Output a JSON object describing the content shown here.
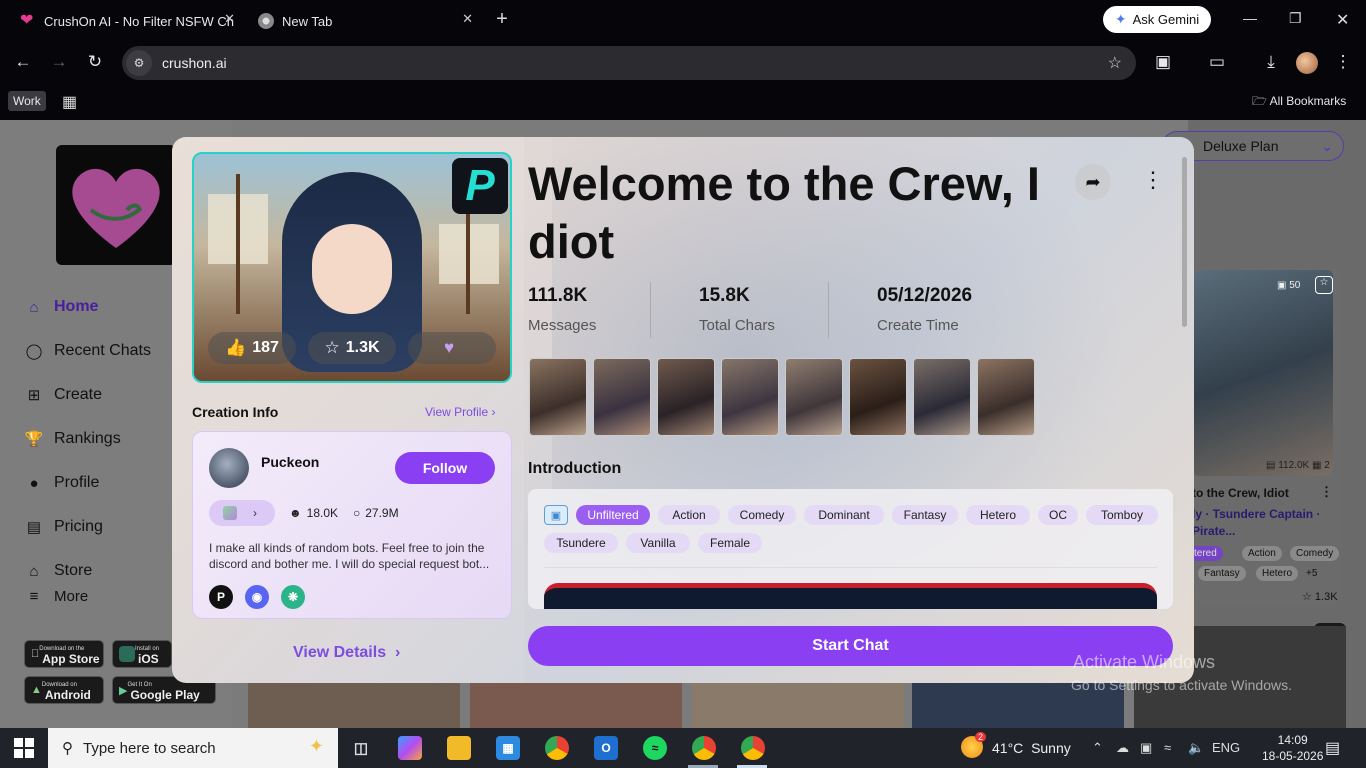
{
  "browser": {
    "tabs": [
      {
        "title": "CrushOn AI - No Filter NSFW Ch",
        "icon": "heart-icon"
      },
      {
        "title": "New Tab",
        "icon": "chrome-icon"
      }
    ],
    "gemini_label": "Ask Gemini",
    "url": "crushon.ai",
    "bookmarks": {
      "workspace": "Work",
      "all": "All Bookmarks"
    }
  },
  "sidebar": {
    "nav": [
      {
        "label": "Home",
        "icon": "home-icon"
      },
      {
        "label": "Recent Chats",
        "icon": "chat-bubble-icon"
      },
      {
        "label": "Create",
        "icon": "plus-square-icon"
      },
      {
        "label": "Rankings",
        "icon": "trophy-icon"
      },
      {
        "label": "Profile",
        "icon": "person-icon"
      },
      {
        "label": "Pricing",
        "icon": "card-icon"
      },
      {
        "label": "Store",
        "icon": "store-icon"
      },
      {
        "label": "More",
        "icon": "menu-icon"
      }
    ],
    "badges": {
      "appstore_small": "Download on the",
      "appstore": "App Store",
      "ios_small": "Install on",
      "ios": "iOS",
      "android_small": "Download on",
      "android": "Android",
      "gplay_small": "Get It On",
      "gplay": "Google Play"
    }
  },
  "header": {
    "plan": "Deluxe Plan"
  },
  "right_card": {
    "img_count": "50",
    "messages": "112.0K",
    "pics": "2",
    "title": "to the Crew, Idiot",
    "subtitle_1": "ly · Tsundere Captain ·",
    "subtitle_2": "Pirate...",
    "tags": [
      "tered",
      "Action",
      "Comedy",
      "Fantasy",
      "Hetero",
      "+5"
    ],
    "likes": "1.3K"
  },
  "modal": {
    "title": "Welcome to the Crew, Idiot",
    "likes": "187",
    "favorites": "1.3K",
    "stats": [
      {
        "value": "111.8K",
        "label": "Messages"
      },
      {
        "value": "15.8K",
        "label": "Total Chars"
      },
      {
        "value": "05/12/2026",
        "label": "Create Time"
      }
    ],
    "creation_label": "Creation Info",
    "view_profile": "View Profile",
    "creator": {
      "name": "Puckeon",
      "follow": "Follow",
      "followers": "18.0K",
      "messages": "27.9M",
      "bio": "I make all kinds of random bots. Feel free to join the discord and bother me. I will do special request bot..."
    },
    "view_details": "View Details",
    "intro_label": "Introduction",
    "tags": [
      "Unfiltered",
      "Action",
      "Comedy",
      "Dominant",
      "Fantasy",
      "Hetero",
      "OC",
      "Tomboy",
      "Tsundere",
      "Vanilla",
      "Female"
    ],
    "start_chat": "Start Chat"
  },
  "watermark": {
    "line1": "Activate Windows",
    "line2": "Go to Settings to activate Windows."
  },
  "taskbar": {
    "search_placeholder": "Type here to search",
    "weather_temp": "41°C",
    "weather_cond": "Sunny",
    "lang": "ENG",
    "time": "14:09",
    "date": "18-05-2026",
    "weather_badge": "2"
  }
}
